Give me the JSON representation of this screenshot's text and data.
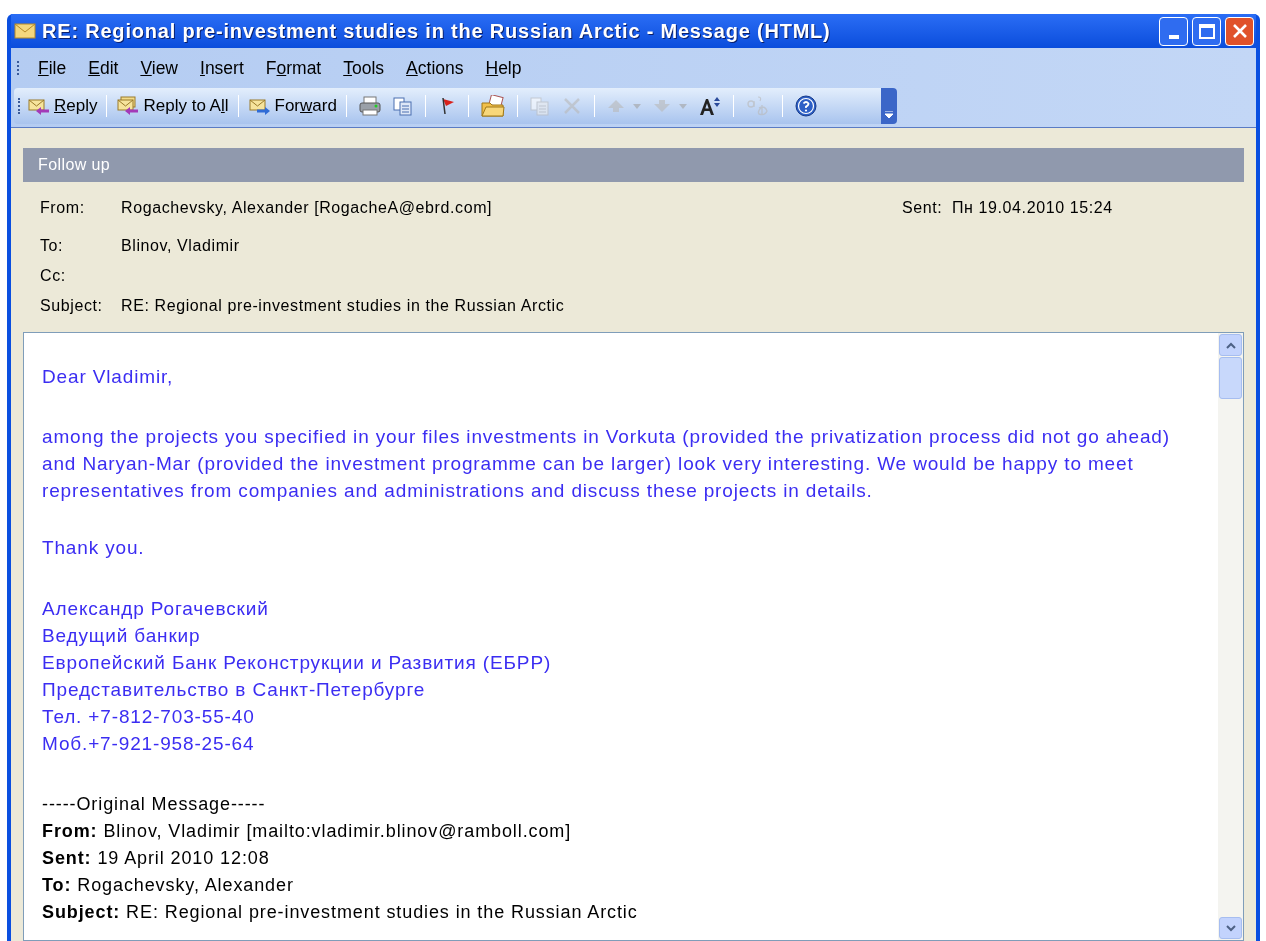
{
  "window": {
    "title": "RE: Regional pre-investment studies in the Russian Arctic - Message (HTML)"
  },
  "menu": [
    {
      "label": {
        "key": "F",
        "after": "ile"
      }
    },
    {
      "label": {
        "key": "E",
        "after": "dit"
      }
    },
    {
      "label": {
        "key": "V",
        "after": "iew"
      }
    },
    {
      "label": {
        "key": "I",
        "after": "nsert"
      }
    },
    {
      "label": {
        "before": "F",
        "key": "o",
        "after": "rmat"
      }
    },
    {
      "label": {
        "key": "T",
        "after": "ools"
      }
    },
    {
      "label": {
        "key": "A",
        "after": "ctions"
      }
    },
    {
      "label": {
        "key": "H",
        "after": "elp"
      }
    }
  ],
  "toolbar": [
    {
      "kind": "reply",
      "label": {
        "key": "R",
        "after": "eply"
      },
      "disabled": false
    },
    {
      "kind": "separator"
    },
    {
      "kind": "reply-all",
      "label": {
        "before": "Reply to A",
        "key": "l",
        "after": "l"
      },
      "disabled": false
    },
    {
      "kind": "separator"
    },
    {
      "kind": "forward",
      "label": {
        "before": "For",
        "key": "w",
        "after": "ard"
      },
      "disabled": false
    },
    {
      "kind": "separator"
    },
    {
      "kind": "print",
      "disabled": false
    },
    {
      "kind": "copy",
      "disabled": false
    },
    {
      "kind": "separator"
    },
    {
      "kind": "flag",
      "disabled": false
    },
    {
      "kind": "separator"
    },
    {
      "kind": "move",
      "disabled": false
    },
    {
      "kind": "separator"
    },
    {
      "kind": "copy",
      "disabled": true
    },
    {
      "kind": "delete",
      "disabled": true
    },
    {
      "kind": "separator"
    },
    {
      "kind": "previous",
      "disabled": true,
      "has_dropdown": true
    },
    {
      "kind": "next",
      "disabled": true,
      "has_dropdown": true
    },
    {
      "kind": "font-size",
      "disabled": false
    },
    {
      "kind": "separator"
    },
    {
      "kind": "translate",
      "disabled": true
    },
    {
      "kind": "separator"
    },
    {
      "kind": "help",
      "disabled": false
    }
  ],
  "follow_up": "Follow up",
  "header": {
    "from_label": "From:",
    "from": "Rogachevsky, Alexander [RogacheA@ebrd.com]",
    "sent_label": "Sent:",
    "sent": "Пн 19.04.2010 15:24",
    "to_label": "To:",
    "to": "Blinov, Vladimir",
    "cc_label": "Cc:",
    "subject_label": "Subject:",
    "subject": "RE: Regional pre-investment studies in the Russian Arctic"
  },
  "body": {
    "greeting": "Dear Vladimir,",
    "paragraph": "among the projects you specified in your files investments in Vorkuta (provided the privatization process did not go ahead) and Naryan-Mar (provided the investment programme can be larger) look very interesting. We would be happy to meet representatives from companies and administrations and discuss these projects in details.",
    "closing": "Thank you.",
    "signature": [
      "Александр Рогачевский",
      "Ведущий банкир",
      "Европейский Банк Реконструкции и Развития (ЕБРР)",
      "Представительство в Санкт-Петербурге",
      "Тел. +7-812-703-55-40",
      "Моб.+7-921-958-25-64"
    ],
    "original_separator": "-----Original Message-----",
    "original": [
      "**From:** Blinov, Vladimir [mailto:vladimir.blinov@ramboll.com]",
      "**Sent:** 19 April 2010 12:08",
      "**To:** Rogachevsky, Alexander",
      "**Subject:** RE: Regional pre-investment studies in the Russian Arctic"
    ]
  }
}
